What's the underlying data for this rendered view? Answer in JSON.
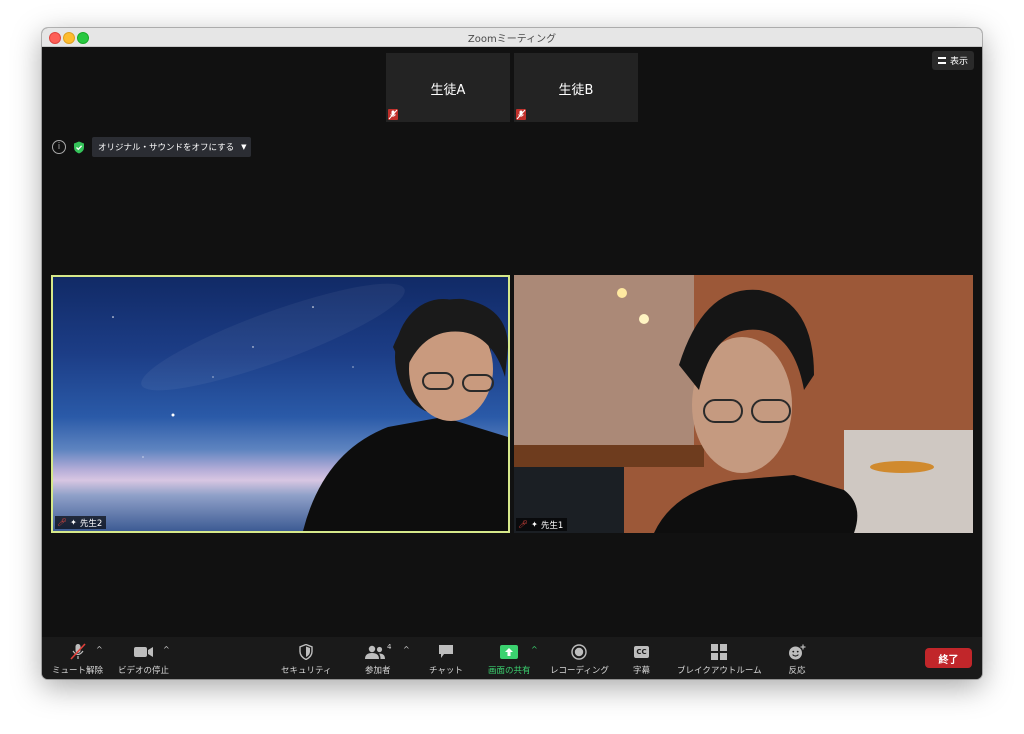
{
  "window": {
    "title": "Zoomミーティング"
  },
  "top_right": {
    "view_label": "表示"
  },
  "thumbnails": [
    {
      "name": "生徒A"
    },
    {
      "name": "生徒B"
    }
  ],
  "info_bar": {
    "sound_button_label": "オリジナル・サウンドをオフにする"
  },
  "tiles": [
    {
      "name": "先生2",
      "active_speaker": true
    },
    {
      "name": "先生1",
      "active_speaker": false
    }
  ],
  "toolbar": {
    "unmute_label": "ミュート解除",
    "stop_video_label": "ビデオの停止",
    "security_label": "セキュリティ",
    "participants_label": "参加者",
    "participants_count": "4",
    "chat_label": "チャット",
    "share_label": "画面の共有",
    "record_label": "レコーディング",
    "captions_label": "字幕",
    "captions_icon_text": "CC",
    "breakout_label": "ブレイクアウトルーム",
    "reactions_label": "反応",
    "end_label": "終了"
  },
  "colors": {
    "share_green": "#3bd16f",
    "active_speaker_border": "#d6e88a",
    "end_red": "#c1262a",
    "mute_red": "#c0302b"
  }
}
